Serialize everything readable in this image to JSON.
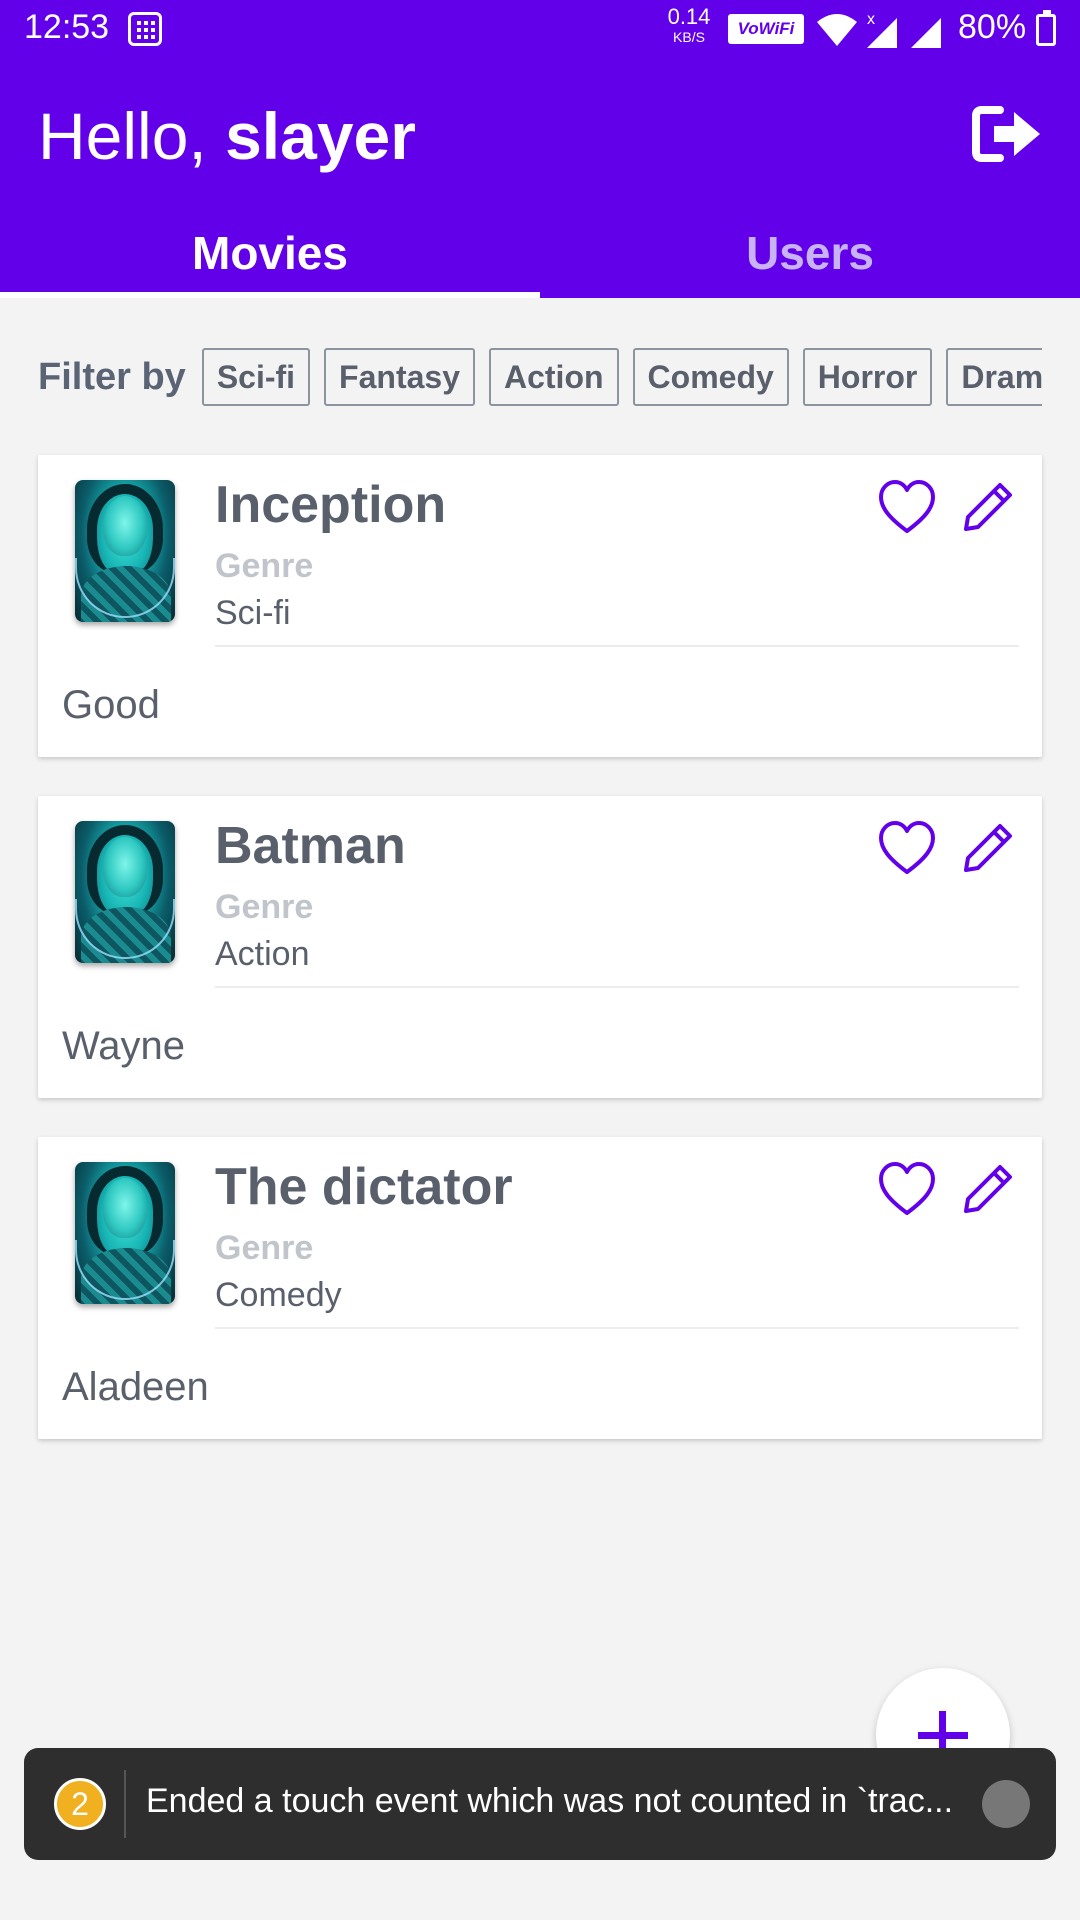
{
  "status_bar": {
    "time": "12:53",
    "net_speed_value": "0.14",
    "net_speed_unit": "KB/S",
    "wifi_badge": "VoWiFi",
    "battery": "80%"
  },
  "header": {
    "greeting_prefix": "Hello,",
    "username": "slayer"
  },
  "tabs": [
    {
      "label": "Movies",
      "active": true
    },
    {
      "label": "Users",
      "active": false
    }
  ],
  "filter": {
    "label": "Filter by",
    "chips": [
      "Sci-fi",
      "Fantasy",
      "Action",
      "Comedy",
      "Horror",
      "Drama"
    ]
  },
  "movies": [
    {
      "title": "Inception",
      "genre_label": "Genre",
      "genre": "Sci-fi",
      "description": "Good"
    },
    {
      "title": "Batman",
      "genre_label": "Genre",
      "genre": "Action",
      "description": "Wayne"
    },
    {
      "title": "The dictator",
      "genre_label": "Genre",
      "genre": "Comedy",
      "description": "Aladeen"
    }
  ],
  "toast": {
    "count": "2",
    "message": "Ended a touch event which was not counted in `trac..."
  },
  "colors": {
    "primary": "#6200ea",
    "text": "#59606c",
    "muted": "#c0c4cb"
  },
  "icons": {
    "logout": "logout-icon",
    "favorite": "heart-outline-icon",
    "edit": "pencil-icon",
    "add": "plus-icon"
  }
}
